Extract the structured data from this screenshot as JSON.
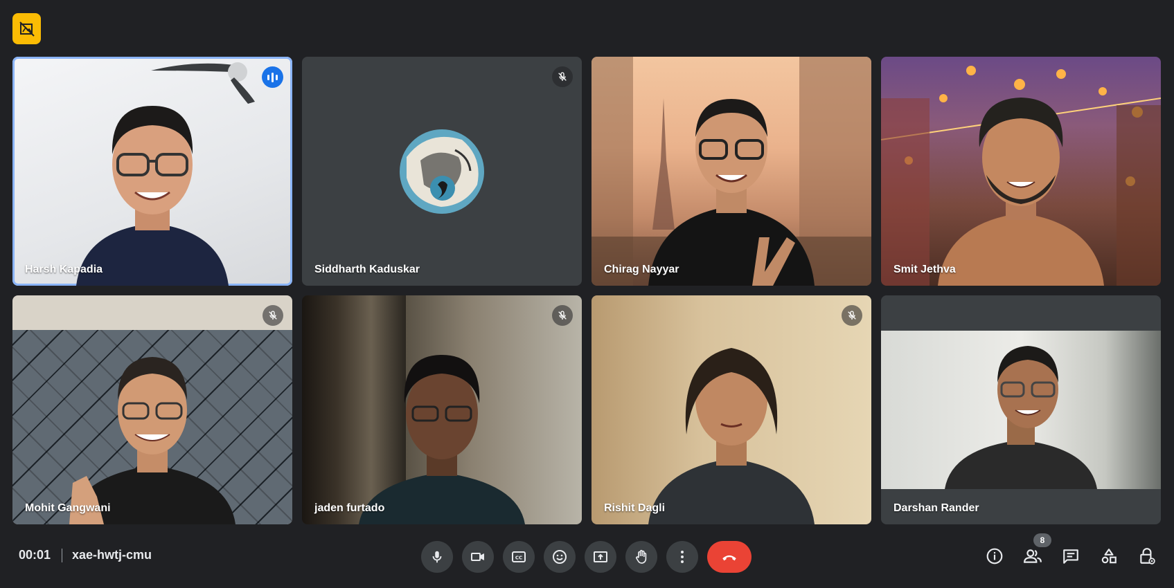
{
  "meeting": {
    "elapsed": "00:01",
    "code": "xae-hwtj-cmu",
    "participant_count": "8"
  },
  "participants": [
    {
      "name": "Harsh Kapadia"
    },
    {
      "name": "Siddharth Kaduskar"
    },
    {
      "name": "Chirag Nayyar"
    },
    {
      "name": "Smit Jethva"
    },
    {
      "name": "Mohit Gangwani"
    },
    {
      "name": "jaden furtado"
    },
    {
      "name": "Rishit Dagli"
    },
    {
      "name": "Darshan Rander"
    }
  ],
  "controls": [
    "microphone-icon",
    "camera-icon",
    "captions-icon",
    "emoji-icon",
    "present-screen-icon",
    "raise-hand-icon",
    "more-options-icon",
    "end-call-icon"
  ],
  "right_controls": [
    "info-icon",
    "people-icon",
    "chat-icon",
    "activities-icon",
    "host-controls-icon"
  ],
  "colors": {
    "accent": "#8ab4f8",
    "end_call": "#ea4335",
    "badge": "#fbbc04",
    "speaking": "#1a73e8"
  }
}
